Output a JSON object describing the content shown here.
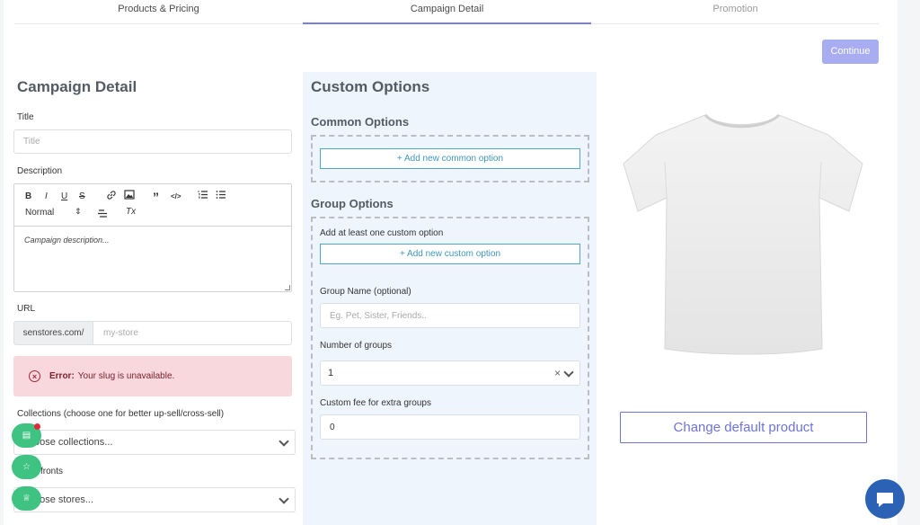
{
  "tabs": [
    {
      "label": "Products & Pricing",
      "state": "normal"
    },
    {
      "label": "Campaign Detail",
      "state": "active"
    },
    {
      "label": "Promotion",
      "state": "disabled"
    }
  ],
  "continue_label": "Continue",
  "left": {
    "heading": "Campaign Detail",
    "title_label": "Title",
    "title_placeholder": "Title",
    "description_label": "Description",
    "editor_toolbar": {
      "bold": "B",
      "italic": "I",
      "underline": "U",
      "strike": "S",
      "heading_select": "Normal",
      "clear_format": "Tx"
    },
    "editor_placeholder": "Campaign description...",
    "url_label": "URL",
    "url_prefix": "senstores.com/",
    "url_placeholder": "my-store",
    "error_strong": "Error:",
    "error_text": "Your slug is unavailable.",
    "collections_label": "Collections (choose one for better up-sell/cross-sell)",
    "collections_placeholder": "oose collections...",
    "storefronts_label": "fronts",
    "storefronts_placeholder": "oose stores..."
  },
  "middle": {
    "heading": "Custom Options",
    "common_heading": "Common Options",
    "add_common": "+ Add new common option",
    "group_heading": "Group Options",
    "group_hint": "Add at least one custom option",
    "add_custom": "+ Add new custom option",
    "group_name_label": "Group Name (optional)",
    "group_name_placeholder": "Eg. Pet, Sister, Friends..",
    "num_groups_label": "Number of groups",
    "num_groups_value": "1",
    "fee_label": "Custom fee for extra groups",
    "fee_value": "0"
  },
  "right": {
    "change_product": "Change default product"
  },
  "colors": {
    "accent": "#7b7fe0",
    "float_green": "#3ec383",
    "error_bg": "#f8d7dd",
    "chat_blue": "#2c62b5"
  },
  "icons": [
    "list-icon",
    "star-icon",
    "trophy-icon",
    "chat-icon",
    "error-circle-icon",
    "chevron-down-icon",
    "clear-icon"
  ]
}
